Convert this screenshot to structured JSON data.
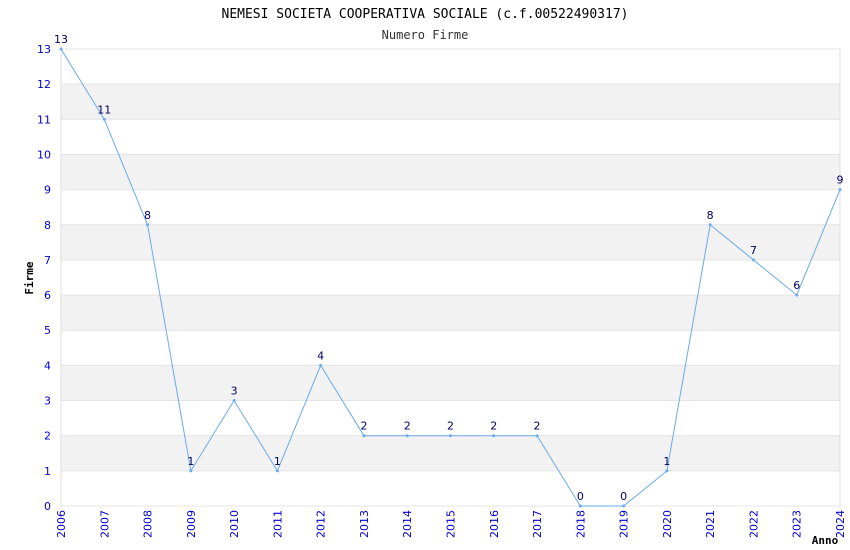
{
  "chart_data": {
    "type": "line",
    "title": "NEMESI SOCIETA COOPERATIVA SOCIALE (c.f.00522490317)",
    "subtitle": "Numero Firme",
    "xlabel": "Anno",
    "ylabel": "Firme",
    "x": [
      "2006",
      "2007",
      "2008",
      "2009",
      "2010",
      "2011",
      "2012",
      "2013",
      "2014",
      "2015",
      "2016",
      "2017",
      "2018",
      "2019",
      "2020",
      "2021",
      "2022",
      "2023",
      "2024"
    ],
    "series": [
      {
        "values": [
          13,
          11,
          8,
          1,
          3,
          1,
          4,
          2,
          2,
          2,
          2,
          2,
          0,
          0,
          1,
          8,
          7,
          6,
          9
        ]
      }
    ],
    "ylim": [
      0,
      13
    ],
    "yticks": [
      "0",
      "1",
      "2",
      "3",
      "4",
      "5",
      "6",
      "7",
      "8",
      "9",
      "10",
      "11",
      "12",
      "13"
    ],
    "grid": true,
    "colors": {
      "line": "#6aaaee",
      "band": "#f2f2f2",
      "tick_text": "#0000cc",
      "data_label": "#000066"
    }
  }
}
